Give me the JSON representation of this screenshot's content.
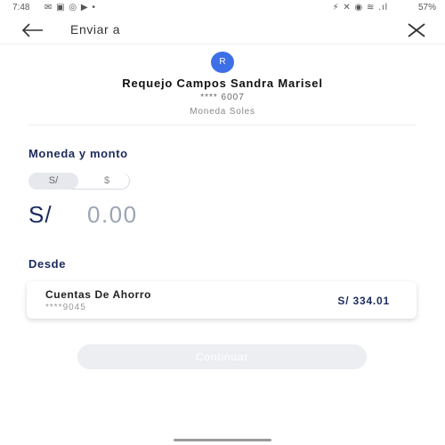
{
  "status_bar": {
    "time": "7:48",
    "left_icons": "✉ ▣ ◎ ▶ •",
    "right_icons": "⚡ ✕ ◉ ≋ .ıl",
    "battery": "57%"
  },
  "header": {
    "back_icon": "arrow-left-icon",
    "title": "Enviar a",
    "close_icon": "close-icon"
  },
  "recipient": {
    "initial": "R",
    "name": "Requejo Campos Sandra Marisel",
    "account_masked": "**** 6007",
    "currency_label": "Moneda Soles"
  },
  "amount_section": {
    "label": "Moneda y monto",
    "currency_options": [
      "S/",
      "$"
    ],
    "selected_currency": "S/",
    "symbol": "S/",
    "value": "0.00"
  },
  "from_section": {
    "label": "Desde",
    "account": {
      "type": "Cuentas De Ahorro",
      "number_masked": "****9045",
      "balance": "S/ 334.01"
    }
  },
  "actions": {
    "continue_label": "Continuar"
  },
  "colors": {
    "accent": "#3d6fe6",
    "navy": "#1c2a5e",
    "disabled": "#eceef2"
  }
}
